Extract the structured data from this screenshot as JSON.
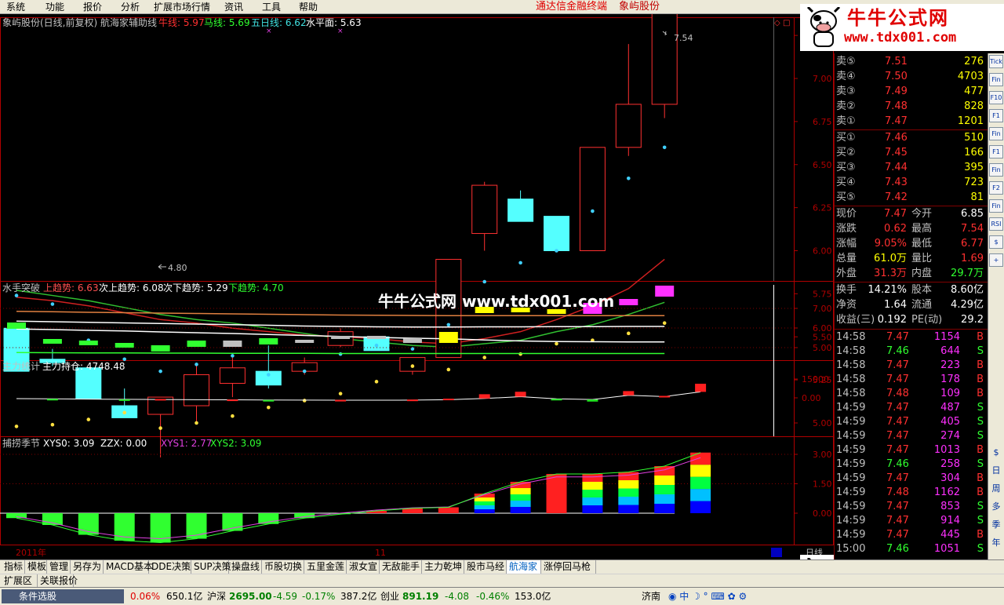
{
  "menu": {
    "items": [
      "系统",
      "功能",
      "报价",
      "分析",
      "扩展市场行情",
      "资讯",
      "工具",
      "帮助"
    ],
    "center_title": "通达信金融终端",
    "stock": "象屿股份"
  },
  "logo": {
    "title": "牛牛公式网",
    "url": "www.tdx001.com"
  },
  "main_panel": {
    "title": "象屿股份(日线,前复权) 航海家辅助线",
    "niu_label": "牛线: 5.97",
    "ma_label": "马线: 5.69",
    "ma5_label": "五日线: 6.62",
    "level_label": "水平面: 5.63",
    "high_mark": "7.54",
    "low_mark": "4.80",
    "yticks": [
      "7.25",
      "7.00",
      "6.75",
      "6.50",
      "6.25",
      "6.00",
      "5.75",
      "5.50",
      "5.25",
      "5.00"
    ],
    "candles": [
      {
        "o": 5.55,
        "h": 5.55,
        "l": 5.3,
        "c": 5.3
      },
      {
        "o": 5.37,
        "h": 5.43,
        "l": 5.33,
        "c": 5.35
      },
      {
        "o": 5.32,
        "h": 5.32,
        "l": 5.14,
        "c": 5.14
      },
      {
        "o": 5.1,
        "h": 5.2,
        "l": 5.03,
        "c": 5.03
      },
      {
        "o": 5.05,
        "h": 5.15,
        "l": 4.8,
        "c": 5.15
      },
      {
        "o": 5.1,
        "h": 5.35,
        "l": 5.0,
        "c": 5.28
      },
      {
        "o": 5.23,
        "h": 5.38,
        "l": 5.15,
        "c": 5.32
      },
      {
        "o": 5.3,
        "h": 5.45,
        "l": 5.2,
        "c": 5.22
      },
      {
        "o": 5.3,
        "h": 5.38,
        "l": 5.28,
        "c": 5.35
      },
      {
        "o": 5.45,
        "h": 5.55,
        "l": 5.44,
        "c": 5.53
      },
      {
        "o": 5.5,
        "h": 5.5,
        "l": 5.42,
        "c": 5.42
      },
      {
        "o": 5.3,
        "h": 5.38,
        "l": 5.28,
        "c": 5.38
      },
      {
        "o": 5.38,
        "h": 5.95,
        "l": 5.38,
        "c": 5.95
      },
      {
        "o": 6.1,
        "h": 6.4,
        "l": 6.0,
        "c": 6.38
      },
      {
        "o": 6.3,
        "h": 6.35,
        "l": 6.17,
        "c": 6.17
      },
      {
        "o": 6.2,
        "h": 6.2,
        "l": 6.0,
        "c": 6.0
      },
      {
        "o": 6.0,
        "h": 6.6,
        "l": 6.0,
        "c": 6.6
      },
      {
        "o": 6.6,
        "h": 7.2,
        "l": 6.55,
        "c": 6.85
      },
      {
        "o": 6.85,
        "h": 7.54,
        "l": 6.77,
        "c": 7.47
      }
    ],
    "dots_blue": [
      5.74,
      5.69,
      5.48,
      5.37,
      5.3,
      5.34,
      5.39,
      5.28,
      5.3,
      5.4,
      5.45,
      5.43,
      5.57,
      5.82,
      5.93,
      6.0,
      6.23,
      6.42,
      6.6
    ],
    "dots_yellow": [
      4.98,
      4.99,
      5.02,
      5.06,
      4.97,
      5.0,
      5.04,
      5.09,
      5.13,
      5.17,
      5.24,
      5.33,
      5.31,
      5.38,
      5.4,
      5.46,
      5.48,
      5.52,
      5.58
    ],
    "niu_line": [
      5.73,
      5.71,
      5.68,
      5.64,
      5.6,
      5.58,
      5.55,
      5.53,
      5.51,
      5.5,
      5.49,
      5.47,
      5.46,
      5.49,
      5.53,
      5.6,
      5.68,
      5.78,
      5.95
    ],
    "ma_line": [
      5.77,
      5.74,
      5.71,
      5.67,
      5.63,
      5.6,
      5.58,
      5.55,
      5.52,
      5.49,
      5.47,
      5.45,
      5.44,
      5.46,
      5.48,
      5.53,
      5.57,
      5.63,
      5.7
    ]
  },
  "shoushou_panel": {
    "title": "水手突破",
    "up_trend": "上趋势: 6.63",
    "sub_up": "次上趋势: 6.08",
    "sub_down": "次下趋势: 5.29",
    "down_trend": "下趋势: 4.70",
    "watermark": "牛牛公式网 www.tdx001.com",
    "yticks": [
      "7.00",
      "6.00",
      "5.00"
    ]
  },
  "zhuli_panel": {
    "title": "主力统计",
    "hold": "主力持仓: 4748.48",
    "yticks": [
      "15000",
      "0.00"
    ]
  },
  "season_panel": {
    "title": "捕捞季节",
    "xys0": "XYS0: 3.09",
    "zzx": "ZZX: 0.00",
    "xys1": "XYS1: 2.77",
    "xys2": "XYS2: 3.09",
    "yticks": [
      "3.00",
      "1.50",
      "0.00"
    ],
    "axis_left": "2011年",
    "axis_mid": "11",
    "axis_right": "日线",
    "bars": [
      -0.25,
      -0.6,
      -1.1,
      -1.4,
      -1.5,
      -1.3,
      -0.9,
      -0.55,
      -0.25,
      -0.05,
      0.12,
      0.25,
      0.3,
      1.0,
      1.6,
      2.0,
      2.0,
      2.1,
      2.4,
      3.09
    ]
  },
  "quote": {
    "sells": [
      {
        "label": "卖⑤",
        "price": "7.51",
        "vol": "276"
      },
      {
        "label": "卖④",
        "price": "7.50",
        "vol": "4703"
      },
      {
        "label": "卖③",
        "price": "7.49",
        "vol": "477"
      },
      {
        "label": "卖②",
        "price": "7.48",
        "vol": "828"
      },
      {
        "label": "卖①",
        "price": "7.47",
        "vol": "1201"
      }
    ],
    "buys": [
      {
        "label": "买①",
        "price": "7.46",
        "vol": "510"
      },
      {
        "label": "买②",
        "price": "7.45",
        "vol": "166"
      },
      {
        "label": "买③",
        "price": "7.44",
        "vol": "395"
      },
      {
        "label": "买④",
        "price": "7.43",
        "vol": "723"
      },
      {
        "label": "买⑤",
        "price": "7.42",
        "vol": "81"
      }
    ],
    "stats": [
      {
        "l1": "现价",
        "v1": "7.47",
        "l2": "今开",
        "v2": "6.85"
      },
      {
        "l1": "涨跌",
        "v1": "0.62",
        "l2": "最高",
        "v2": "7.54"
      },
      {
        "l1": "涨幅",
        "v1": "9.05%",
        "l2": "最低",
        "v2": "6.77"
      },
      {
        "l1": "总量",
        "v1": "61.0万",
        "l2": "量比",
        "v2": "1.69"
      },
      {
        "l1": "外盘",
        "v1": "31.3万",
        "l2": "内盘",
        "v2": "29.7万"
      }
    ],
    "stats2": [
      {
        "l1": "换手",
        "v1": "14.21%",
        "l2": "股本",
        "v2": "8.60亿"
      },
      {
        "l1": "净资",
        "v1": "1.64",
        "l2": "流通",
        "v2": "4.29亿"
      },
      {
        "l1": "收益(三)",
        "v1": "0.192",
        "l2": "PE(动)",
        "v2": "29.2"
      }
    ],
    "ticks": [
      {
        "t": "14:58",
        "p": "7.47",
        "v": "1154",
        "s": "B"
      },
      {
        "t": "14:58",
        "p": "7.46",
        "v": "644",
        "s": "S"
      },
      {
        "t": "14:58",
        "p": "7.47",
        "v": "223",
        "s": "B"
      },
      {
        "t": "14:58",
        "p": "7.47",
        "v": "178",
        "s": "B"
      },
      {
        "t": "14:58",
        "p": "7.48",
        "v": "109",
        "s": "B"
      },
      {
        "t": "14:59",
        "p": "7.47",
        "v": "487",
        "s": "S"
      },
      {
        "t": "14:59",
        "p": "7.47",
        "v": "405",
        "s": "S"
      },
      {
        "t": "14:59",
        "p": "7.47",
        "v": "274",
        "s": "S"
      },
      {
        "t": "14:59",
        "p": "7.47",
        "v": "1013",
        "s": "B"
      },
      {
        "t": "14:59",
        "p": "7.46",
        "v": "258",
        "s": "S"
      },
      {
        "t": "14:59",
        "p": "7.47",
        "v": "304",
        "s": "B"
      },
      {
        "t": "14:59",
        "p": "7.48",
        "v": "1162",
        "s": "B"
      },
      {
        "t": "14:59",
        "p": "7.47",
        "v": "853",
        "s": "S"
      },
      {
        "t": "14:59",
        "p": "7.47",
        "v": "914",
        "s": "S"
      },
      {
        "t": "14:59",
        "p": "7.47",
        "v": "445",
        "s": "B"
      },
      {
        "t": "15:00",
        "p": "7.46",
        "v": "1051",
        "s": "S"
      }
    ]
  },
  "side_icons": [
    "Tick",
    "Fin",
    "F10",
    "F1",
    "Fin",
    "F1",
    "Fin",
    "F2",
    "Fin",
    "RSI",
    "$",
    "+",
    "$",
    "日",
    "周",
    "多",
    "季",
    "年"
  ],
  "tabs": [
    "指标",
    "模板",
    "管理",
    "另存为",
    "MACD基本",
    "DDE决策",
    "SUP决策",
    "操盘线",
    "币股切换",
    "五里金莲",
    "淑女宣",
    "无敌能手",
    "主力乾坤",
    "股市马经",
    "航海家",
    "涨停回马枪"
  ],
  "tabs2": [
    "扩展区",
    "关联报价"
  ],
  "status": {
    "search": "条件选股",
    "pct": "0.06%",
    "amt1": "650.1亿",
    "hs_label": "沪深",
    "hs_val": "2695.00",
    "hs_chg": "-4.59",
    "hs_pct": "-0.17%",
    "hs_amt": "387.2亿",
    "cy_label": "创业",
    "cy_val": "891.19",
    "cy_chg": "-4.08",
    "cy_pct": "-0.46%",
    "cy_amt": "153.0亿",
    "city": "济南"
  }
}
